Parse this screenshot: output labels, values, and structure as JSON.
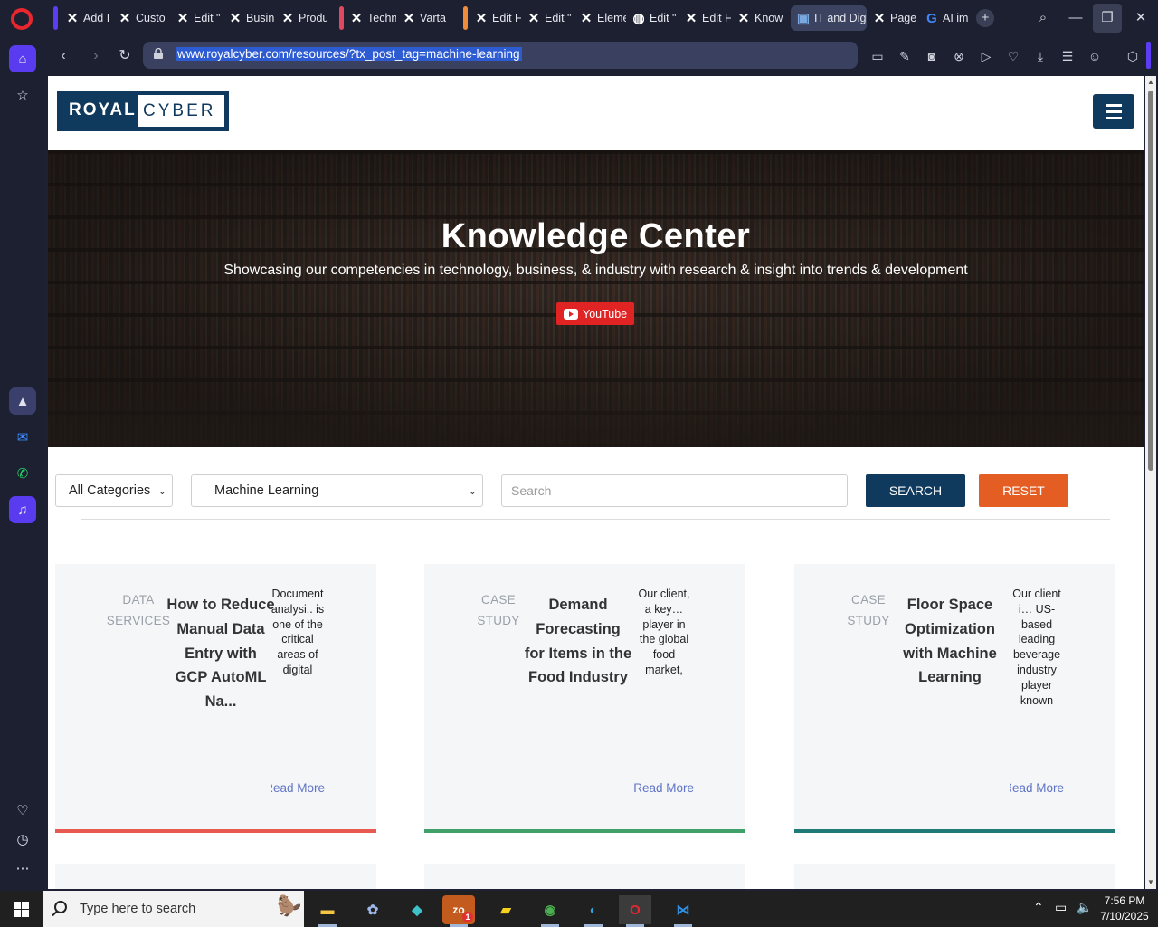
{
  "browser": {
    "tabs": [
      {
        "label": "Add I",
        "icon": "x-logo-icon"
      },
      {
        "label": "Custo",
        "icon": "x-logo-icon"
      },
      {
        "label": "Edit \"",
        "icon": "x-logo-icon"
      },
      {
        "label": "Busin",
        "icon": "x-logo-icon"
      },
      {
        "label": "Produ",
        "icon": "x-logo-icon"
      },
      {
        "label": "Techn",
        "icon": "x-logo-icon"
      },
      {
        "label": "Varta",
        "icon": "x-logo-icon"
      },
      {
        "label": "Edit F",
        "icon": "x-logo-icon"
      },
      {
        "label": "Edit \"",
        "icon": "x-logo-icon"
      },
      {
        "label": "Eleme",
        "icon": "x-logo-icon"
      },
      {
        "label": "Edit \"",
        "icon": "globe-icon"
      },
      {
        "label": "Edit F",
        "icon": "x-logo-icon"
      },
      {
        "label": "Know",
        "icon": "x-logo-icon"
      },
      {
        "label": "IT and Dig",
        "icon": "site-icon"
      },
      {
        "label": "Page",
        "icon": "x-logo-icon"
      },
      {
        "label": "AI im",
        "icon": "google-icon"
      }
    ],
    "group_colors": [
      "#5b3df5",
      "#e0485f",
      "#ef8c3a"
    ],
    "active_tab_index": 13,
    "address": "www.royalcyber.com/resources/?tx_post_tag=machine-learning"
  },
  "site": {
    "logo_left": "ROYAL",
    "logo_right": "CYBER",
    "brand_color": "#0f3a5d",
    "hero_title": "Knowledge Center",
    "hero_subtitle": "Showcasing our competencies in technology, business, & industry with research & insight into trends & development",
    "youtube_label": "YouTube",
    "filters": {
      "category_selected": "All Categories",
      "tag_selected": "Machine Learning",
      "search_placeholder": "Search",
      "search_button": "SEARCH",
      "reset_button": "RESET",
      "search_color": "#0f3a5d",
      "reset_color": "#e45d23"
    },
    "cards": [
      {
        "category": "DATA SERVICES",
        "title": "How to Reduce Manual Data Entry with GCP AutoML Na...",
        "excerpt": "Document analysi.. is one of the critical areas of digital",
        "more": "Read More",
        "accent": "#e8594f"
      },
      {
        "category": "CASE STUDY",
        "title": "Demand Forecasting for Items in the Food Industry",
        "excerpt": "Our client, a key… player in the global food market,",
        "more": "Read More",
        "accent": "#3fa06a"
      },
      {
        "category": "CASE STUDY",
        "title": "Floor Space Optimization with Machine Learning",
        "excerpt": "Our client i… US-based leading beverage industry player known",
        "more": "Read More",
        "accent": "#1f7a78"
      }
    ]
  },
  "taskbar": {
    "search_placeholder": "Type here to search",
    "time": "7:56 PM",
    "date": "7/10/2025",
    "zoom_badge": "1"
  }
}
